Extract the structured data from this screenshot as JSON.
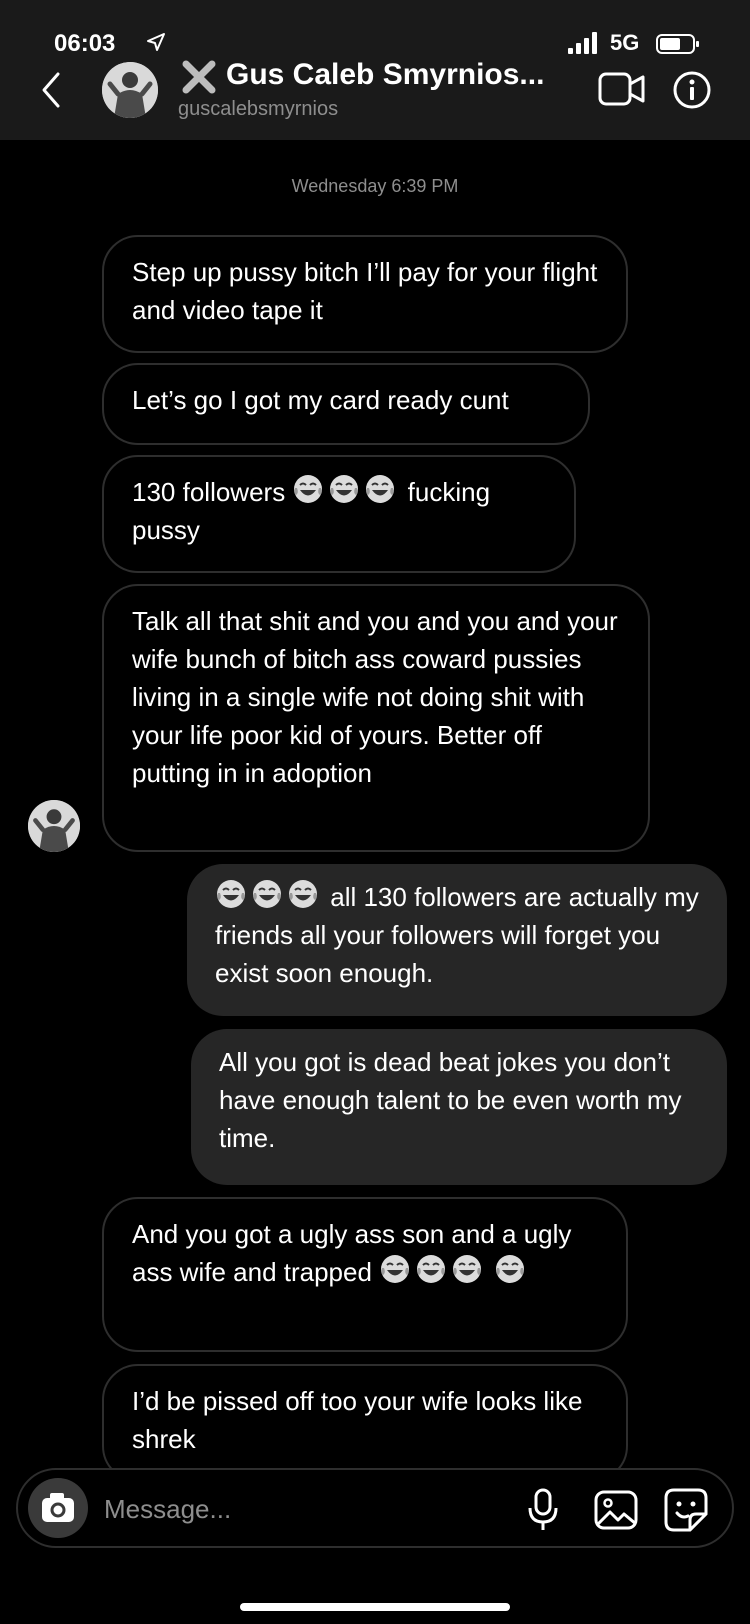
{
  "status_bar": {
    "time": "06:03",
    "network": "5G"
  },
  "header": {
    "name": "Gus Caleb Smyrnios...",
    "username": "guscalebsmyrnios"
  },
  "conversation": {
    "timestamp": "Wednesday 6:39 PM",
    "messages": [
      {
        "from": "them",
        "text": "Step up pussy bitch I’ll pay for your flight and video tape it"
      },
      {
        "from": "them",
        "text": "Let’s go I got my card ready cunt"
      },
      {
        "from": "them",
        "before": "130 followers",
        "emoji": "face-with-tears-of-joy",
        "emoji_count": 3,
        "after": "fucking pussy"
      },
      {
        "from": "them",
        "text": "Talk all that shit and you and you and your wife bunch of bitch ass coward pussies living in a single wife not doing shit with your life poor kid of yours. Better off putting in in adoption"
      },
      {
        "from": "me",
        "emoji": "face-with-tears-of-joy",
        "emoji_count": 3,
        "after": "all 130 followers are actually my friends all your followers will forget you exist soon enough."
      },
      {
        "from": "me",
        "text": "All you got is dead beat jokes you don’t have enough talent to be even worth my time."
      },
      {
        "from": "them",
        "before": "And you got a ugly ass son and a ugly ass wife and trapped",
        "emoji": "face-with-tears-of-joy",
        "emoji_count": 4
      },
      {
        "from": "them",
        "text": "I’d be pissed off too your wife looks like shrek"
      }
    ]
  },
  "composer": {
    "placeholder": "Message..."
  },
  "icons": {
    "back": "chevron-left-icon",
    "video": "video-camera-icon",
    "info": "info-icon",
    "camera": "camera-icon",
    "mic": "microphone-icon",
    "gallery": "gallery-icon",
    "sticker": "sticker-icon"
  },
  "colors": {
    "background": "#000000",
    "header": "#1a1a1a",
    "outgoing_bubble": "#262626",
    "incoming_border": "#2e2e2e",
    "muted_text": "#8e8e8e"
  }
}
